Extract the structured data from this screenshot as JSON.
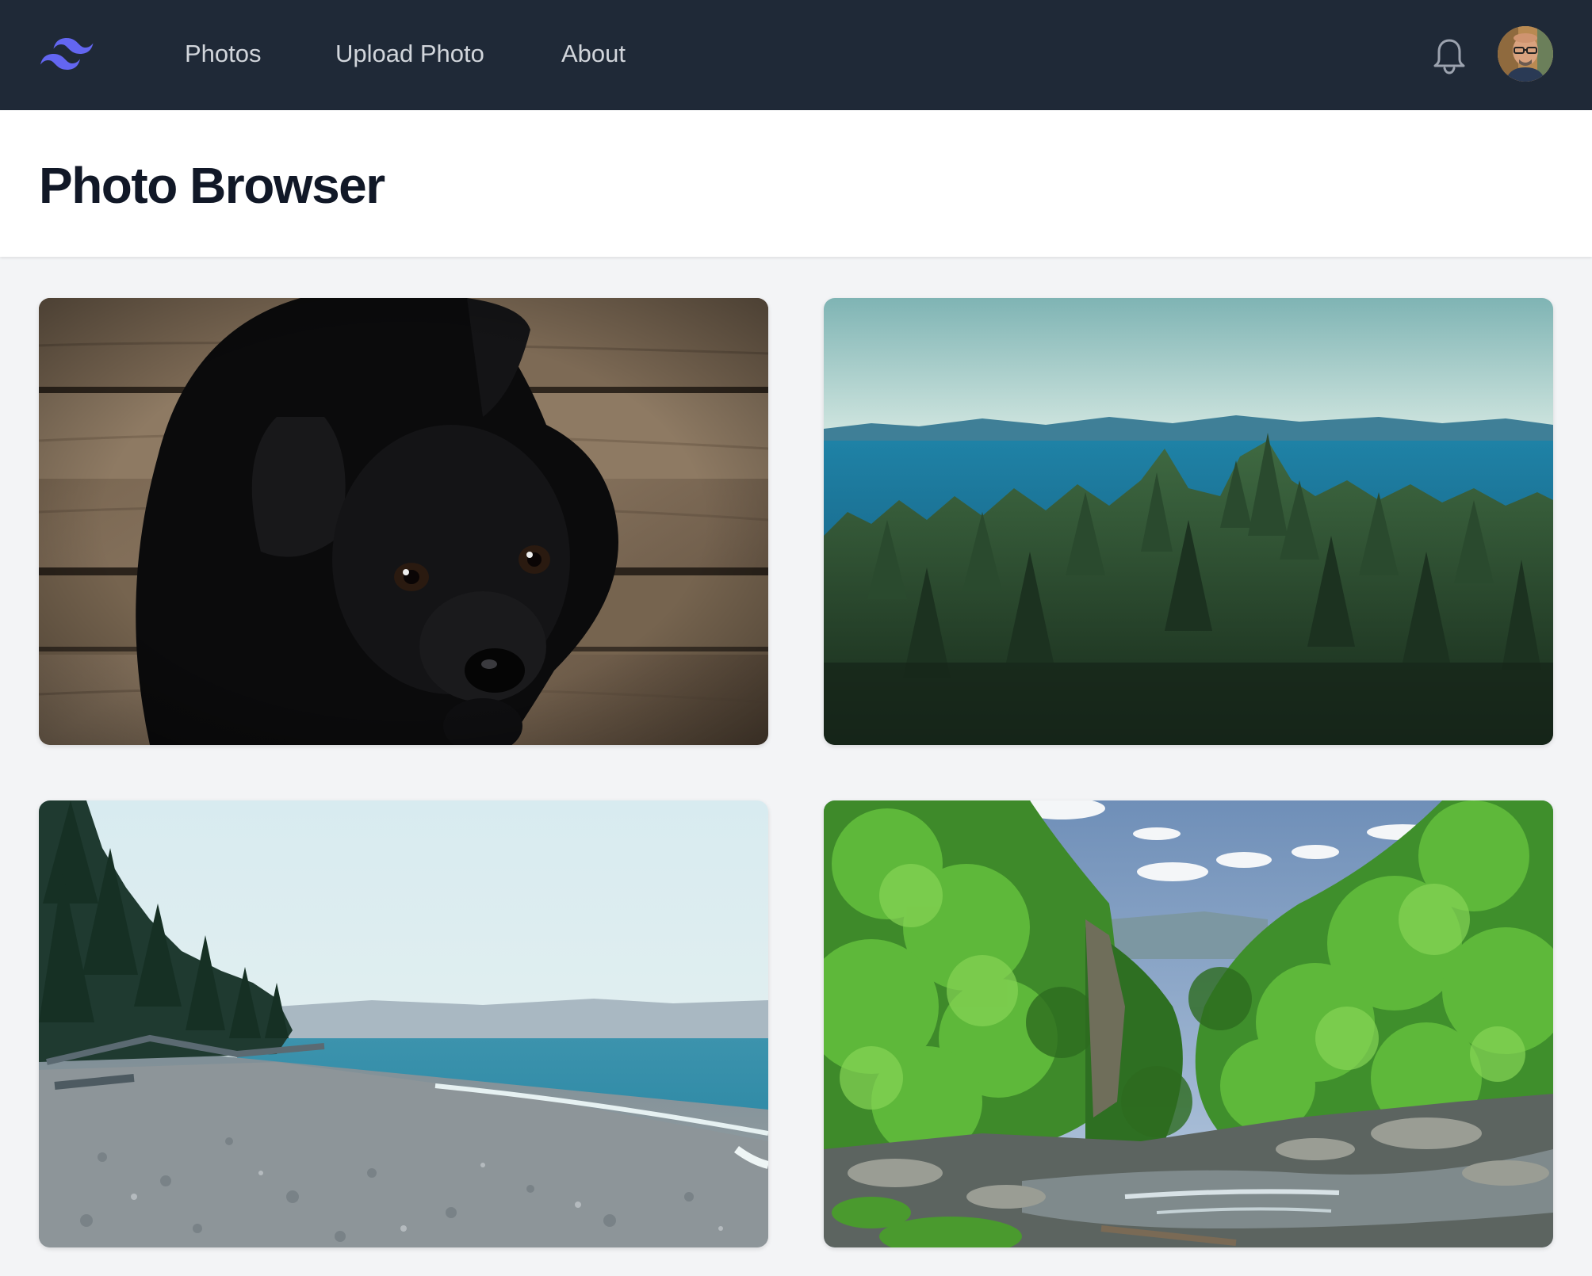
{
  "nav": {
    "links": [
      {
        "label": "Photos"
      },
      {
        "label": "Upload Photo"
      },
      {
        "label": "About"
      }
    ],
    "logo_icon": "tailwind-logo-icon",
    "notifications_icon": "bell-icon",
    "accent_color": "#6366f1",
    "background_color": "#1f2937"
  },
  "header": {
    "title": "Photo Browser"
  },
  "gallery": {
    "photos": [
      {
        "subject": "black-puppy-on-wooden-floor"
      },
      {
        "subject": "forest-overlooking-sea"
      },
      {
        "subject": "pebble-beach-with-trees"
      },
      {
        "subject": "green-forest-with-rocky-stream"
      }
    ]
  }
}
